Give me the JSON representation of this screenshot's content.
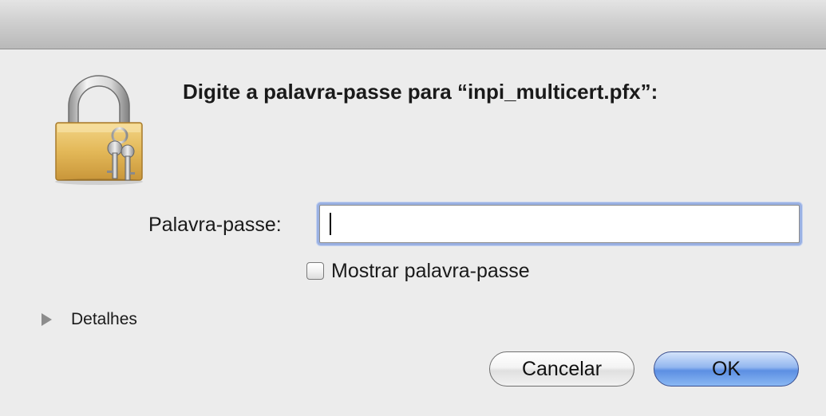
{
  "dialog": {
    "prompt": "Digite a palavra-passe para “inpi_multicert.pfx”:",
    "password_label": "Palavra-passe:",
    "password_value": "",
    "show_password_label": "Mostrar palavra-passe",
    "show_password_checked": false,
    "details_label": "Detalhes",
    "cancel_label": "Cancelar",
    "ok_label": "OK"
  },
  "icons": {
    "lock": "keychain-lock-icon",
    "disclosure": "disclosure-triangle-icon"
  },
  "colors": {
    "window_bg": "#ececec",
    "focus_ring": "#9ab1e3",
    "default_button": "#5c8fe3"
  }
}
